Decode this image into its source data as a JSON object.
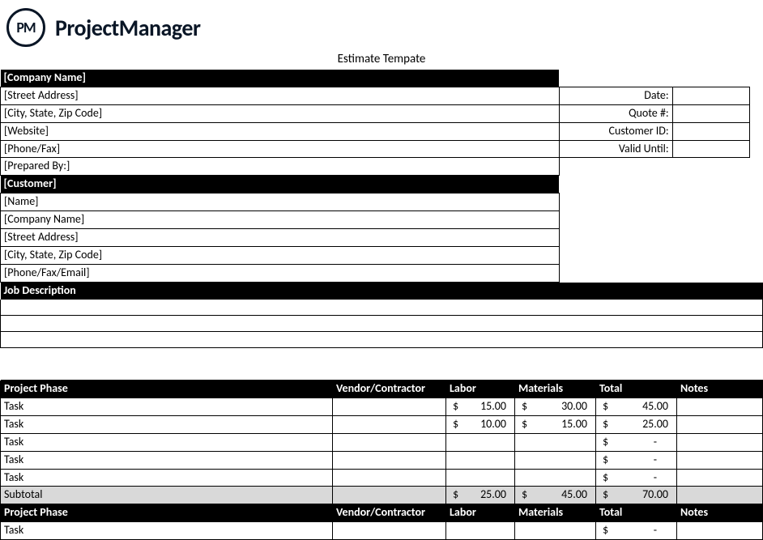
{
  "brand": {
    "logo_text": "PM",
    "name": "ProjectManager"
  },
  "title": "Estimate Tempate",
  "company_header": "[Company Name]",
  "company_fields": [
    "[Street Address]",
    "[City, State, Zip Code]",
    "[Website]",
    "[Phone/Fax]",
    "[Prepared By:]"
  ],
  "meta_labels": [
    "Date:",
    "Quote #:",
    "Customer ID:",
    "Valid Until:"
  ],
  "meta_values": [
    "",
    "",
    "",
    ""
  ],
  "customer_header": "[Customer]",
  "customer_fields": [
    "[Name]",
    "[Company Name]",
    "[Street Address]",
    "[City, State, Zip Code]",
    "[Phone/Fax/Email]"
  ],
  "job_desc_header": "Job Description",
  "phase_cols": {
    "phase": "Project Phase",
    "vendor": "Vendor/Contractor",
    "labor": "Labor",
    "materials": "Materials",
    "total": "Total",
    "notes": "Notes"
  },
  "phase1": {
    "rows": [
      {
        "task": "Task",
        "vendor": "",
        "labor": "15.00",
        "materials": "30.00",
        "total": "45.00",
        "notes": ""
      },
      {
        "task": "Task",
        "vendor": "",
        "labor": "10.00",
        "materials": "15.00",
        "total": "25.00",
        "notes": ""
      },
      {
        "task": "Task",
        "vendor": "",
        "labor": "",
        "materials": "",
        "total": "-",
        "notes": ""
      },
      {
        "task": "Task",
        "vendor": "",
        "labor": "",
        "materials": "",
        "total": "-",
        "notes": ""
      },
      {
        "task": "Task",
        "vendor": "",
        "labor": "",
        "materials": "",
        "total": "-",
        "notes": ""
      }
    ],
    "subtotal_label": "Subtotal",
    "subtotal": {
      "labor": "25.00",
      "materials": "45.00",
      "total": "70.00"
    }
  },
  "phase2": {
    "rows": [
      {
        "task": "Task",
        "vendor": "",
        "labor": "",
        "materials": "",
        "total": "-",
        "notes": ""
      }
    ]
  },
  "currency": "$"
}
